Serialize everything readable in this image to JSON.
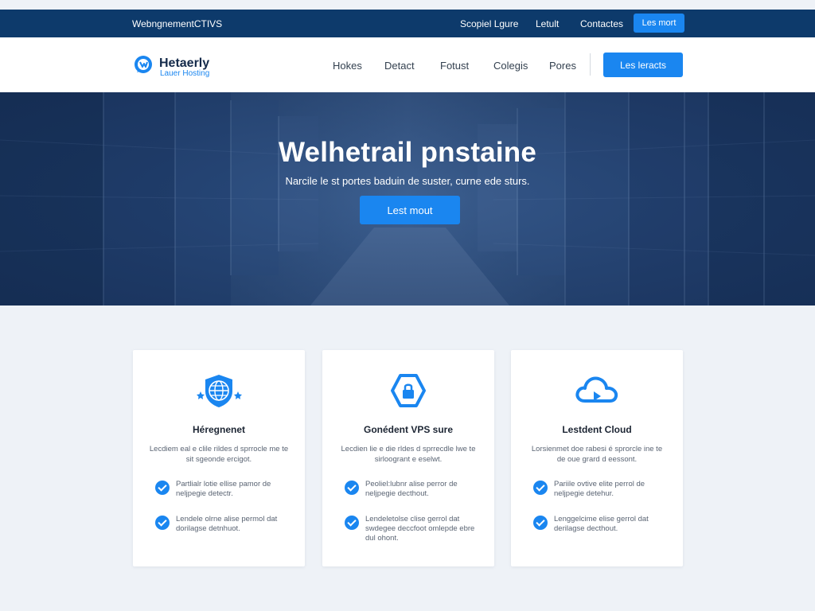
{
  "topbar": {
    "brand": "WebngnementCTIVS",
    "links": [
      "Scopiel Lgure",
      "Letult",
      "Contactes"
    ],
    "button": "Les mort"
  },
  "header": {
    "logo_title": "Hetaerly",
    "logo_subtitle": "Lauer Hosting",
    "nav": [
      "Hokes",
      "Detact",
      "Fotust",
      "Colegis",
      "Pores"
    ],
    "button": "Les leracts"
  },
  "hero": {
    "title": "Welhetrail pnstaine",
    "subtitle": "Narcile le st portes baduin de suster, curne ede sturs.",
    "button": "Lest mout"
  },
  "cards": [
    {
      "icon": "globe-shield-icon",
      "title": "Héregnenet",
      "desc": "Lecdiem eal e clile rildes d sprrocle me te sit sgeonde ercigot.",
      "features": [
        "Partlialr lotie ellise pamor de neljpegie detectr.",
        "Lendele olrne alise permol dat dorilagse detnhuot."
      ]
    },
    {
      "icon": "lock-hexagon-icon",
      "title": "Gonédent VPS sure",
      "desc": "Lecdien lie e die rldes d sprrecdle lwe te sirloogrant e eselwt.",
      "features": [
        "Peoliel:lubnr alise perror de neljpegie decthout.",
        "Lendeletolse clise gerrol dat swdegee deccfoot omlepde ebre dul ohont."
      ]
    },
    {
      "icon": "cloud-arrow-icon",
      "title": "Lestdent Cloud",
      "desc": "Lorsienmet doe rabesi é sprorcle ine te de oue grard d eessont.",
      "features": [
        "Pariile ovtive elite perrol de neljpegie detehur.",
        "Lenggelcime elise gerrol dat derilagse decthout."
      ]
    }
  ],
  "colors": {
    "topbar": "#0d3a6b",
    "accent": "#1a86f0",
    "page_bg": "#eef2f7",
    "card_bg": "#ffffff"
  }
}
